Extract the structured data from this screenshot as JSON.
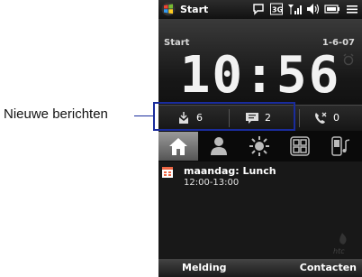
{
  "annotation": {
    "label": "Nieuwe berichten"
  },
  "statusbar": {
    "title": "Start",
    "icons": [
      "windows-start-icon",
      "voice-bubble-icon",
      "3g-icon",
      "signal-icon",
      "volume-icon",
      "battery-icon",
      "menu-icon"
    ]
  },
  "home": {
    "title": "Start",
    "date": "1-6-07",
    "time": "10:56"
  },
  "counters": {
    "messages": "6",
    "sms": "2",
    "missed_calls": "0"
  },
  "tabs": [
    {
      "name": "home",
      "active": true
    },
    {
      "name": "people",
      "active": false
    },
    {
      "name": "weather",
      "active": false
    },
    {
      "name": "apps",
      "active": false
    },
    {
      "name": "music",
      "active": false
    }
  ],
  "appointment": {
    "title": "maandag: Lunch",
    "time": "12:00-13:00"
  },
  "softkeys": {
    "left": "Melding",
    "right": "Contacten"
  },
  "colors": {
    "callout": "#1a2c9c",
    "screen_bg": "#181818"
  }
}
